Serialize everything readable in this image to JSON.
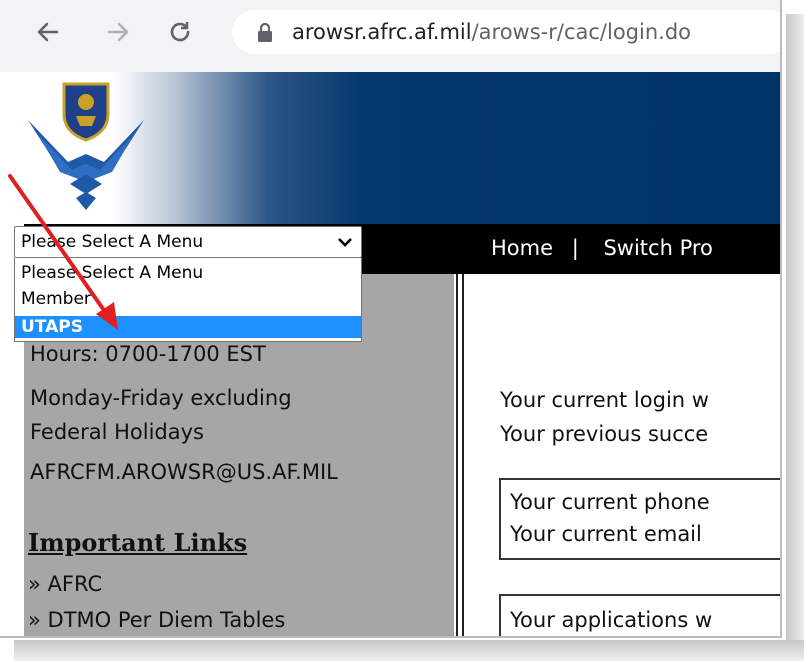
{
  "browser": {
    "url_host": "arowsr.afrc.af.mil",
    "url_path": "/arows-r/cac/login.do",
    "icons": [
      "back-arrow-icon",
      "forward-arrow-icon",
      "reload-icon",
      "lock-icon"
    ]
  },
  "nav": {
    "home": "Home",
    "separator": "|",
    "switch": "Switch Pro"
  },
  "menu_select": {
    "value": "Please Select A Menu",
    "options": [
      "Please Select A Menu",
      "Member",
      "UTAPS"
    ],
    "highlighted": "UTAPS"
  },
  "sidebar": {
    "hours": "Hours: 0700-1700 EST",
    "days": "Monday-Friday excluding",
    "holidays": "Federal Holidays",
    "email": "AFRCFM.AROWSR@US.AF.MIL",
    "links_heading": "Important Links",
    "links": [
      "» AFRC",
      "» DTMO Per Diem Tables"
    ]
  },
  "main": {
    "login_line1": "Your current login w",
    "login_line2": "Your previous succe",
    "contact_line1": "Your current phone",
    "contact_line2": "Your current email",
    "apps_line": "Your applications w"
  },
  "colors": {
    "banner_navy": "#003366",
    "sidebar_gray": "#a6a6a6",
    "selected_option": "#1e90ff",
    "annotation_red": "#e02020"
  }
}
